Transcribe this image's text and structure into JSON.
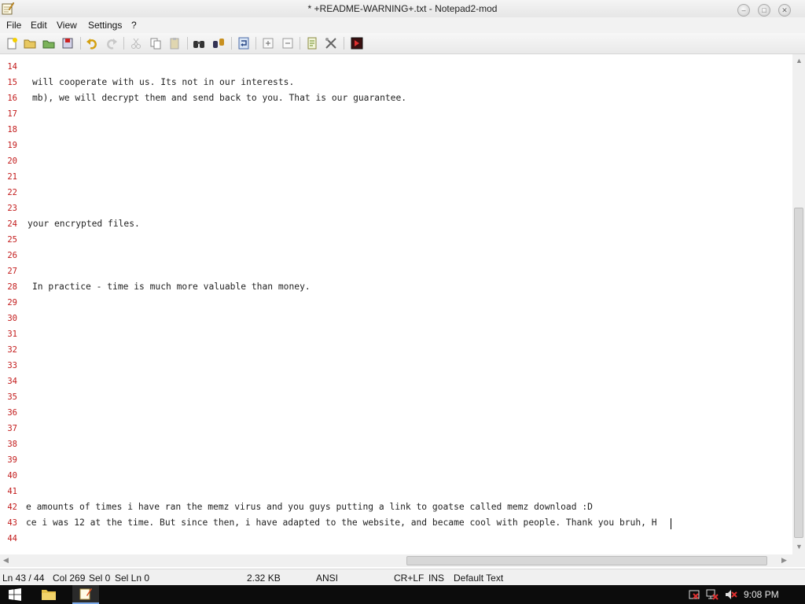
{
  "window": {
    "title": "* +README-WARNING+.txt - Notepad2-mod"
  },
  "menu": {
    "items": [
      "File",
      "Edit",
      "View",
      "Settings",
      "?"
    ]
  },
  "toolbar": {
    "buttons": [
      "new-file-icon",
      "open-folder-icon",
      "browse-icon",
      "save-icon",
      "undo-icon",
      "redo-icon",
      "cut-icon",
      "copy-icon",
      "paste-icon",
      "find-icon",
      "replace-icon",
      "word-wrap-icon",
      "zoom-in-icon",
      "zoom-out-icon",
      "scheme-icon",
      "customize-icon",
      "exit-icon"
    ]
  },
  "editor": {
    "lines": [
      {
        "num": "14",
        "text": ""
      },
      {
        "num": "15",
        "text": "will cooperate with us. Its not in our interests."
      },
      {
        "num": "16",
        "text": "mb), we will decrypt them and send back to you. That is our guarantee."
      },
      {
        "num": "17",
        "text": ""
      },
      {
        "num": "18",
        "text": ""
      },
      {
        "num": "19",
        "text": ""
      },
      {
        "num": "20",
        "text": ""
      },
      {
        "num": "21",
        "text": ""
      },
      {
        "num": "22",
        "text": ""
      },
      {
        "num": "23",
        "text": ""
      },
      {
        "num": "24",
        "text": "your encrypted files."
      },
      {
        "num": "25",
        "text": ""
      },
      {
        "num": "26",
        "text": ""
      },
      {
        "num": "27",
        "text": ""
      },
      {
        "num": "28",
        "text": "In practice - time is much more valuable than money."
      },
      {
        "num": "29",
        "text": ""
      },
      {
        "num": "30",
        "text": ""
      },
      {
        "num": "31",
        "text": ""
      },
      {
        "num": "32",
        "text": ""
      },
      {
        "num": "33",
        "text": ""
      },
      {
        "num": "34",
        "text": ""
      },
      {
        "num": "35",
        "text": ""
      },
      {
        "num": "36",
        "text": ""
      },
      {
        "num": "37",
        "text": ""
      },
      {
        "num": "38",
        "text": ""
      },
      {
        "num": "39",
        "text": ""
      },
      {
        "num": "40",
        "text": ""
      },
      {
        "num": "41",
        "text": ""
      },
      {
        "num": "42",
        "text": "e amounts of times i have ran the memz virus and you guys putting a link to goatse called memz download :D"
      },
      {
        "num": "43",
        "text": "ce i was 12 at the time. But since then, i have adapted to the website, and became cool with people. Thank you bruh, H"
      },
      {
        "num": "44",
        "text": ""
      }
    ]
  },
  "status": {
    "position": "Ln 43 / 44",
    "column": "Col 269",
    "selection": "Sel 0",
    "sel_lines": "Sel Ln 0",
    "size": "2.32 KB",
    "encoding": "ANSI",
    "line_endings": "CR+LF",
    "insert_mode": "INS",
    "scheme": "Default Text"
  },
  "taskbar": {
    "clock": "9:08 PM"
  }
}
